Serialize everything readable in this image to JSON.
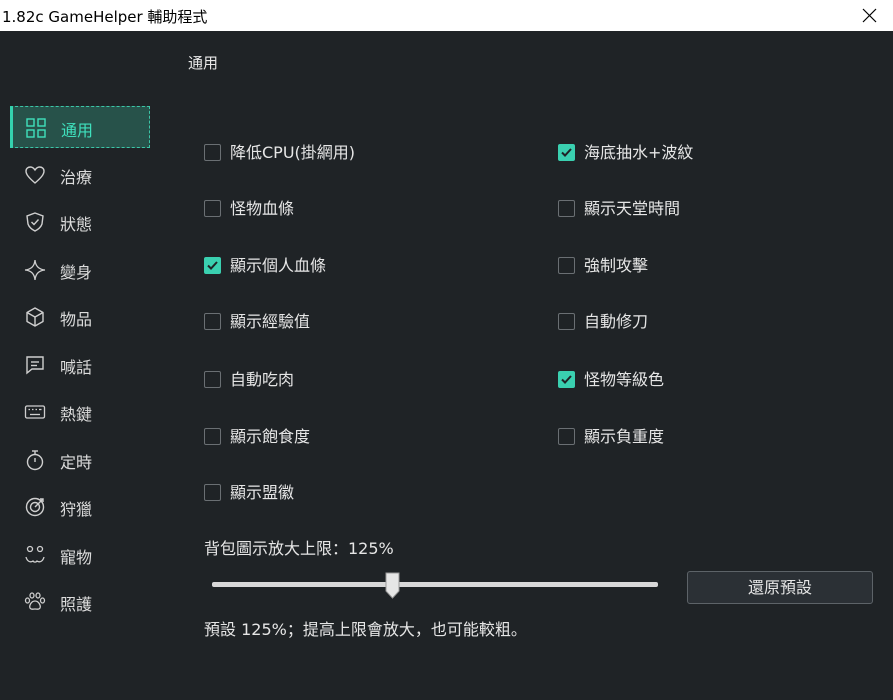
{
  "window": {
    "title": "1.82c GameHelper 輔助程式"
  },
  "header": {
    "title": "通用"
  },
  "sidebar": {
    "items": [
      {
        "label": "通用",
        "icon": "grid-icon",
        "active": true
      },
      {
        "label": "治療",
        "icon": "heart-icon",
        "active": false
      },
      {
        "label": "狀態",
        "icon": "shield-icon",
        "active": false
      },
      {
        "label": "變身",
        "icon": "sparkle-icon",
        "active": false
      },
      {
        "label": "物品",
        "icon": "cube-icon",
        "active": false
      },
      {
        "label": "喊話",
        "icon": "chat-icon",
        "active": false
      },
      {
        "label": "熱鍵",
        "icon": "keyboard-icon",
        "active": false
      },
      {
        "label": "定時",
        "icon": "stopwatch-icon",
        "active": false
      },
      {
        "label": "狩獵",
        "icon": "target-icon",
        "active": false
      },
      {
        "label": "寵物",
        "icon": "pet-face-icon",
        "active": false
      },
      {
        "label": "照護",
        "icon": "paw-icon",
        "active": false
      }
    ]
  },
  "options": {
    "left": [
      {
        "label": "降低CPU(掛網用)",
        "checked": false
      },
      {
        "label": "怪物血條",
        "checked": false
      },
      {
        "label": "顯示個人血條",
        "checked": true
      },
      {
        "label": "顯示經驗值",
        "checked": false
      },
      {
        "label": "自動吃肉",
        "checked": false
      },
      {
        "label": "顯示飽食度",
        "checked": false
      },
      {
        "label": "顯示盟徽",
        "checked": false
      }
    ],
    "right": [
      {
        "label": "海底抽水+波紋",
        "checked": true
      },
      {
        "label": "顯示天堂時間",
        "checked": false
      },
      {
        "label": "強制攻擊",
        "checked": false
      },
      {
        "label": "自動修刀",
        "checked": false
      },
      {
        "label": "怪物等級色",
        "checked": true
      },
      {
        "label": "顯示負重度",
        "checked": false
      }
    ]
  },
  "slider": {
    "label": "背包圖示放大上限：125%",
    "value_percent": 125,
    "position_fraction": 0.405,
    "hint": "預設 125%；提高上限會放大，也可能較粗。"
  },
  "buttons": {
    "reset_label": "還原預設"
  },
  "colors": {
    "accent": "#3ad0b0",
    "background": "#1f2326",
    "active_bg": "#27524a"
  }
}
